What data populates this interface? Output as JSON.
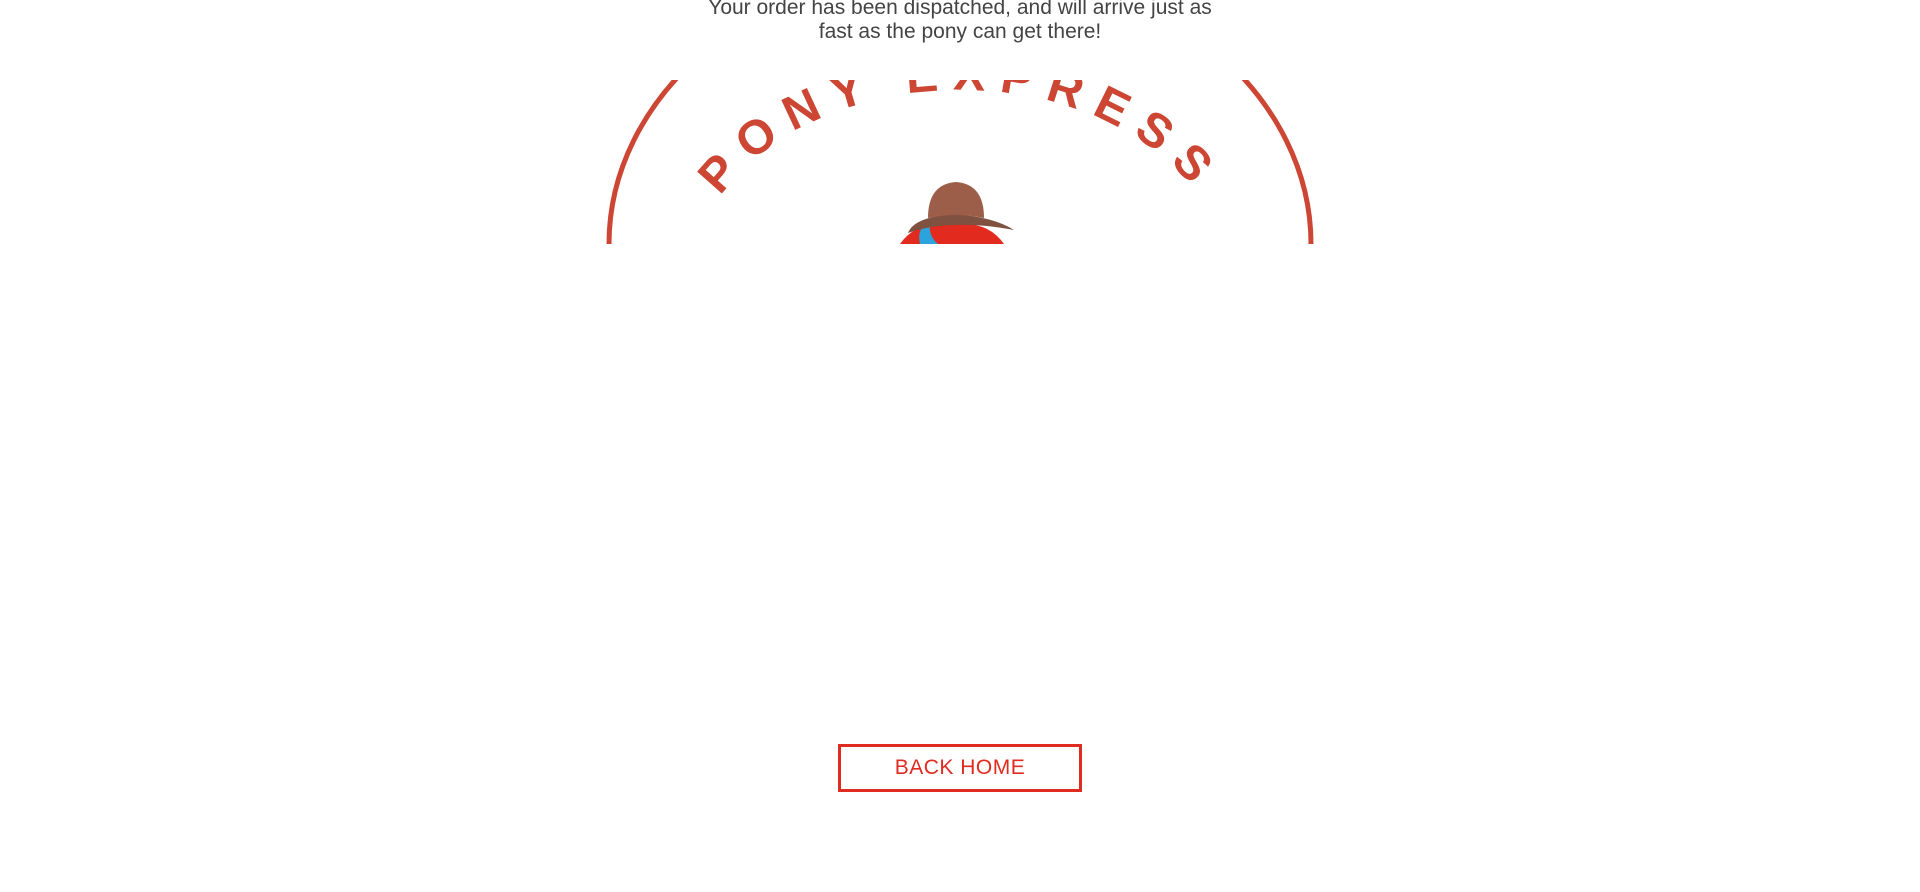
{
  "confirmation": {
    "message_line_1": "Your order has been dispatched, and will arrive just as",
    "message_line_2": "fast as the pony can get there!"
  },
  "logo": {
    "arc_text": "PONY EXPRESS",
    "icon": "pony-express-rider-icon",
    "color": "#cc4633"
  },
  "actions": {
    "back_home_label": "BACK HOME"
  },
  "colors": {
    "accent": "#e02b20",
    "text": "#444444",
    "background": "#ffffff"
  }
}
